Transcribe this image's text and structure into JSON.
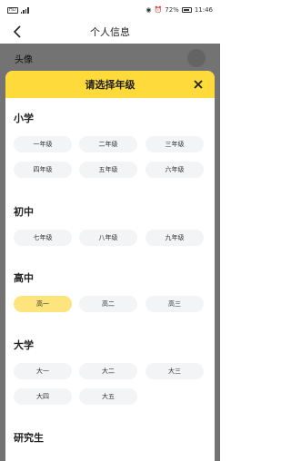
{
  "status": {
    "time": "11:46",
    "battery": "72%",
    "left": "HD"
  },
  "nav": {
    "title": "个人信息"
  },
  "background_row": {
    "label": "头像"
  },
  "sheet": {
    "title": "请选择年级"
  },
  "sections": [
    {
      "title": "小学",
      "items": [
        "一年级",
        "二年级",
        "三年级",
        "四年级",
        "五年级",
        "六年级"
      ]
    },
    {
      "title": "初中",
      "items": [
        "七年级",
        "八年级",
        "九年级"
      ]
    },
    {
      "title": "高中",
      "items": [
        "高一",
        "高二",
        "高三"
      ],
      "selected": "高一"
    },
    {
      "title": "大学",
      "items": [
        "大一",
        "大二",
        "大三",
        "大四",
        "大五"
      ]
    },
    {
      "title": "研究生",
      "items": []
    }
  ],
  "colors": {
    "accent": "#FEDA3A",
    "selected_chip": "#FDE47C",
    "chip": "#F3F4F6"
  }
}
